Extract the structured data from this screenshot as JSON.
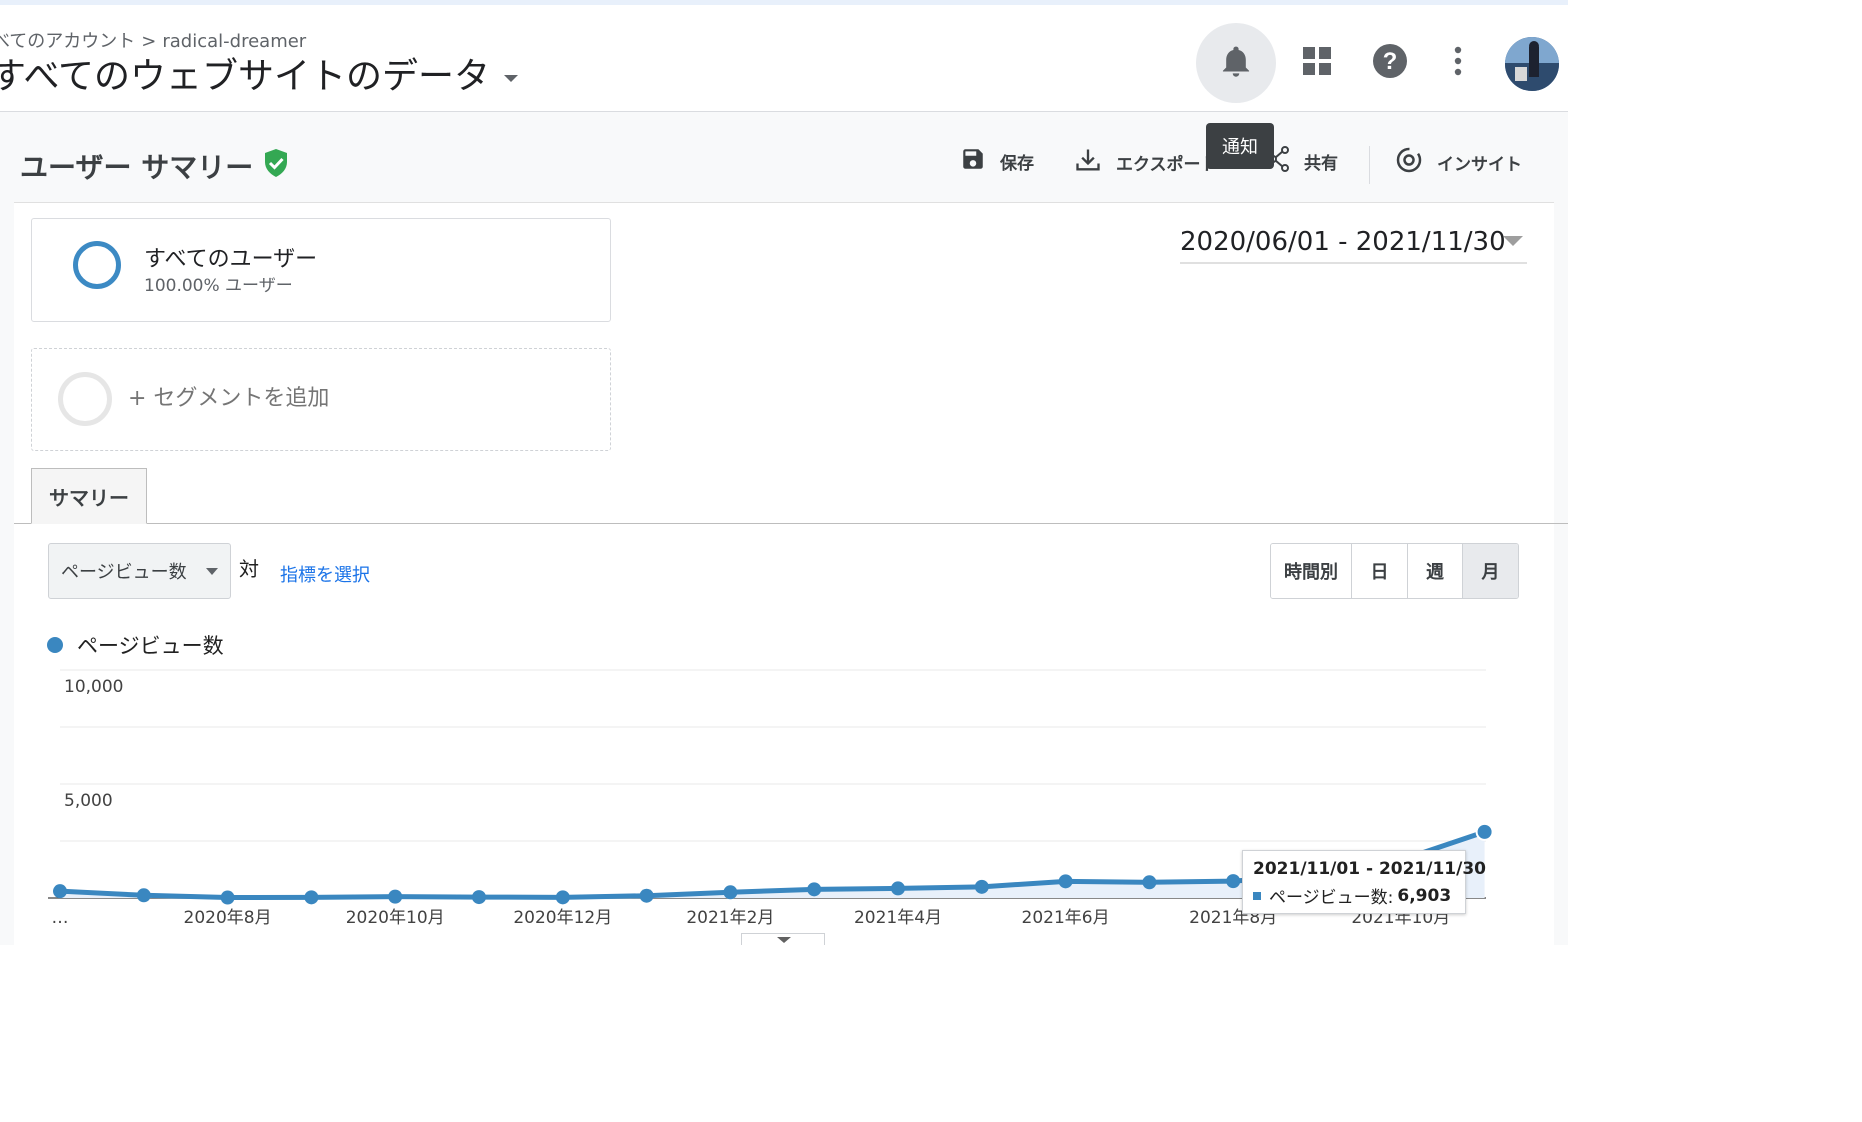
{
  "header": {
    "breadcrumb_account": "べてのアカウント",
    "breadcrumb_sep": ">",
    "breadcrumb_property": "radical-dreamer",
    "view_title": "すべてのウェブサイトのデータ",
    "tooltip": "通知"
  },
  "report": {
    "title": "ユーザー サマリー",
    "actions": {
      "save": "保存",
      "export": "エクスポート",
      "share": "共有",
      "insight": "インサイト"
    },
    "date_range": "2020/06/01 - 2021/11/30"
  },
  "segments": {
    "current_name": "すべてのユーザー",
    "current_sub": "100.00% ユーザー",
    "add_label": "+ セグメントを追加"
  },
  "tabs": {
    "summary": "サマリー"
  },
  "controls": {
    "metric": "ページビュー数",
    "vs": "対",
    "select_metric": "指標を選択",
    "periods": [
      "時間別",
      "日",
      "週",
      "月"
    ],
    "active_period": "月"
  },
  "chart_tooltip": {
    "date": "2021/11/01 - 2021/11/30",
    "label": "ページビュー数:",
    "value": "6,903"
  },
  "chart_data": {
    "type": "area",
    "series": [
      {
        "name": "ページビュー数",
        "color": "#3a87c0",
        "values": [
          300,
          120,
          20,
          30,
          60,
          40,
          30,
          100,
          250,
          380,
          420,
          490,
          730,
          690,
          740,
          1000,
          1660,
          2900
        ]
      }
    ],
    "x": [
      "2020-06",
      "2020-07",
      "2020-08",
      "2020-09",
      "2020-10",
      "2020-11",
      "2020-12",
      "2021-01",
      "2021-02",
      "2021-03",
      "2021-04",
      "2021-05",
      "2021-06",
      "2021-07",
      "2021-08",
      "2021-09",
      "2021-10",
      "2021-11"
    ],
    "x_tick_labels": [
      "…",
      "2020年8月",
      "2020年10月",
      "2020年12月",
      "2021年2月",
      "2021年4月",
      "2021年6月",
      "2021年8月",
      "2021年10月"
    ],
    "y_tick_labels": [
      "10,000",
      "5,000"
    ],
    "ylim": [
      0,
      10000
    ],
    "grid": true,
    "highlight_index": 17
  },
  "colors": {
    "accent": "#3a87c0",
    "link": "#1a73e8",
    "verified": "#34a853"
  }
}
